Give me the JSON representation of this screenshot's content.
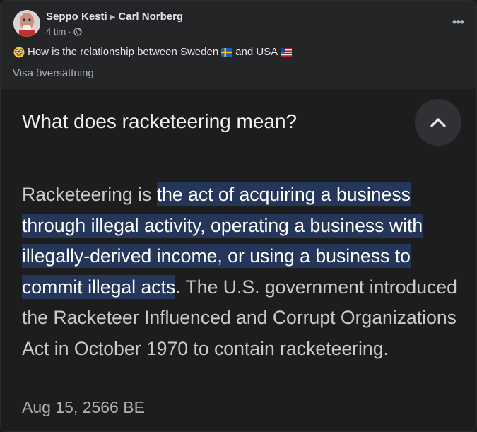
{
  "post": {
    "author": "Seppo Kesti",
    "target": "Carl Norberg",
    "time": "4 tim",
    "separator": "·",
    "text_intro": "How is the relationship between Sweden",
    "text_and": "and USA",
    "translate_link": "Visa översättning"
  },
  "shared_image": {
    "question": "What does racketeering mean?",
    "answer_prefix": "Racketeering is ",
    "answer_highlight": "the act of acquiring a business through illegal activity, operating a business with illegally-derived income, or using a business to commit illegal acts",
    "answer_rest": ". The U.S. government introduced the Racketeer Influenced and Corrupt Organizations Act in October 1970 to contain racketeering.",
    "date": "Aug 15, 2566 BE"
  },
  "icons": {
    "more": "more-options-icon",
    "privacy": "globe-icon",
    "emoji": "nerd-face-emoji-icon",
    "flag_se": "sweden-flag-icon",
    "flag_us": "usa-flag-icon",
    "collapse": "chevron-up-icon"
  },
  "colors": {
    "card_bg": "#242526",
    "image_bg": "#1d1d1e",
    "highlight_bg": "#24375a",
    "secondary_text": "#b0b3b8"
  }
}
